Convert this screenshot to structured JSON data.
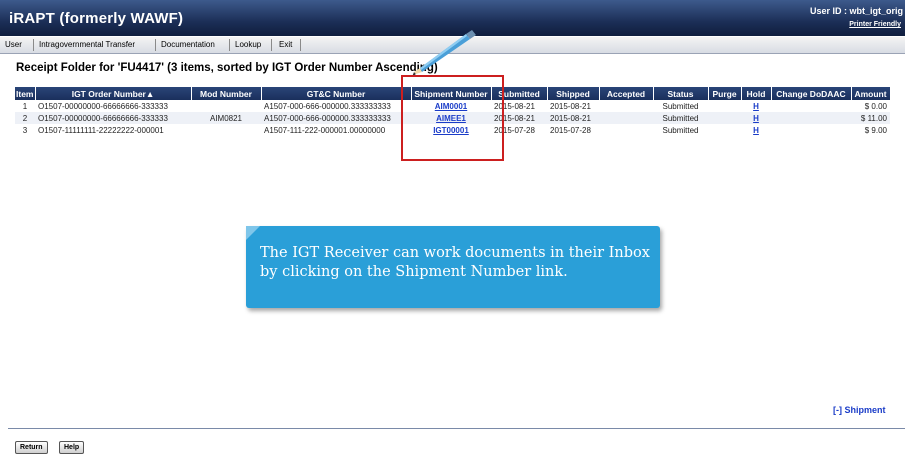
{
  "header": {
    "title": "iRAPT (formerly WAWF)",
    "user_id": "User ID : wbt_igt_orig",
    "printer_friendly": "Printer Friendly"
  },
  "menu": [
    {
      "label": "User"
    },
    {
      "label": "Intragovernmental Transfer"
    },
    {
      "label": "Documentation"
    },
    {
      "label": "Lookup"
    },
    {
      "label": "Exit"
    }
  ],
  "page": {
    "title": "Receipt Folder for 'FU4417' (3 items, sorted by IGT Order Number Ascending)"
  },
  "table": {
    "headers": [
      "Item",
      "IGT Order Number▲",
      "Mod Number",
      "GT&C Number",
      "Shipment Number",
      "Submitted",
      "Shipped",
      "Accepted",
      "Status",
      "Purge",
      "Hold",
      "Change DoDAAC",
      "Amount"
    ],
    "rows": [
      {
        "item": "1",
        "igt_order": "O1507-00000000-66666666-333333",
        "mod": "",
        "gtc": "A1507-000-666-000000.333333333",
        "shipment": "AIM0001",
        "submitted": "2015-08-21",
        "shipped": "2015-08-21",
        "accepted": "",
        "status": "Submitted",
        "purge": "",
        "hold": "H",
        "change_dodaac": "",
        "amount": "$ 0.00"
      },
      {
        "item": "2",
        "igt_order": "O1507-00000000-66666666-333333",
        "mod": "AIM0821",
        "gtc": "A1507-000-666-000000.333333333",
        "shipment": "AIMEE1",
        "submitted": "2015-08-21",
        "shipped": "2015-08-21",
        "accepted": "",
        "status": "Submitted",
        "purge": "",
        "hold": "H",
        "change_dodaac": "",
        "amount": "$ 11.00"
      },
      {
        "item": "3",
        "igt_order": "O1507-11111111-22222222-000001",
        "mod": "",
        "gtc": "A1507-111-222-000001.00000000",
        "shipment": "IGT00001",
        "submitted": "2015-07-28",
        "shipped": "2015-07-28",
        "accepted": "",
        "status": "Submitted",
        "purge": "",
        "hold": "H",
        "change_dodaac": "",
        "amount": "$ 9.00"
      }
    ]
  },
  "callout": {
    "text": "The IGT Receiver can work documents in their Inbox by clicking on the Shipment Number link."
  },
  "footer": {
    "shipment_toggle": "[-] Shipment",
    "return_label": "Return",
    "help_label": "Help"
  },
  "colors": {
    "header_bg": "#1c2f57",
    "table_header_bg": "#1a2f5c",
    "link": "#1a3cc8",
    "callout_bg": "#2a9fd8",
    "highlight_border": "#cc1f1f"
  },
  "icons": {
    "pointer": "pencil-icon"
  }
}
